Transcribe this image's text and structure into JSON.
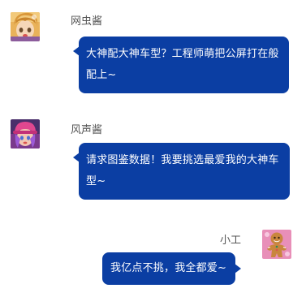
{
  "theme": {
    "bubble_color": "#0b3ea3",
    "bubble_text_color": "#ffffff",
    "name_color": "#555555"
  },
  "messages": [
    {
      "sender": "网虫酱",
      "text": "大神配大神车型？工程师萌把公屏打在般配上~",
      "side": "left",
      "avatar_icon": "anime-girl-blonde-avatar-icon"
    },
    {
      "sender": "风声酱",
      "text": "请求图鉴数据！我要挑选最爱我的大神车型~",
      "side": "left",
      "avatar_icon": "anime-girl-pink-cap-avatar-icon"
    },
    {
      "sender": "小工",
      "text": "我亿点不挑，我全都爱~",
      "side": "right",
      "avatar_icon": "gingerbread-man-avatar-icon"
    }
  ]
}
